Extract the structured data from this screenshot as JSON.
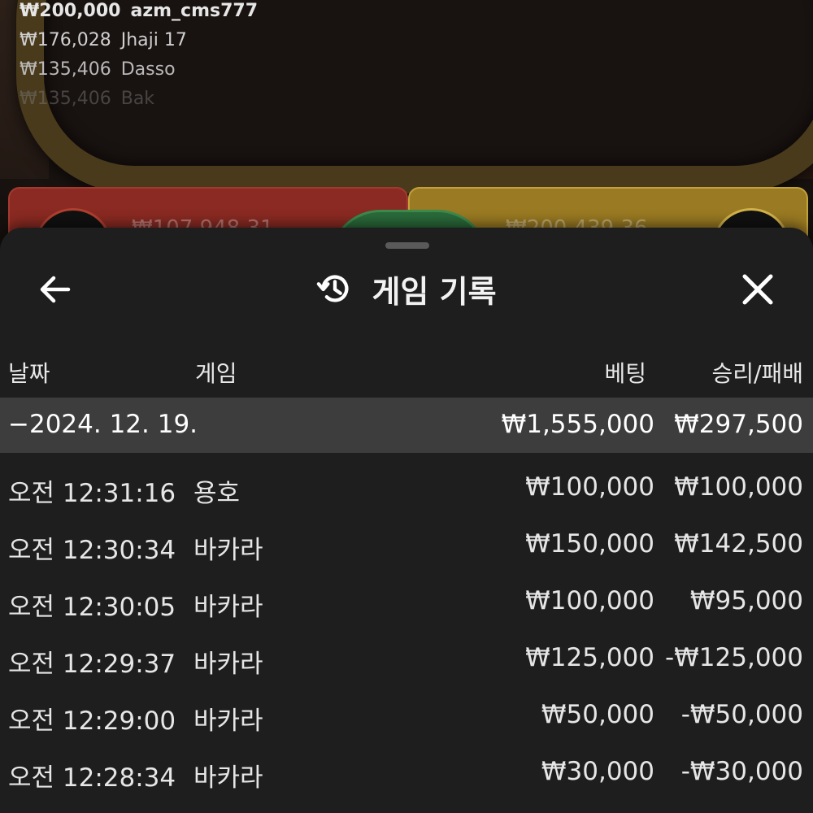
{
  "leaderboard": [
    {
      "amount": "₩200,000",
      "name": "azm_cms777"
    },
    {
      "amount": "₩176,028",
      "name": "Jhaji 17"
    },
    {
      "amount": "₩135,406",
      "name": "Dasso"
    },
    {
      "amount": "₩135,406",
      "name": "Bak"
    }
  ],
  "table": {
    "dragon_total": "₩107,948.31",
    "tiger_total": "₩200,439.36"
  },
  "sheet": {
    "title": "게임 기록",
    "icons": {
      "back": "arrow-left-icon",
      "history": "history-icon",
      "close": "close-icon"
    },
    "columns": {
      "date": "날짜",
      "game": "게임",
      "bet": "베팅",
      "result": "승리/패배"
    },
    "summary": {
      "date": "−2024. 12. 19.",
      "bet": "₩1,555,000",
      "result": "₩297,500"
    },
    "rows": [
      {
        "time": "오전 12:31:16",
        "game": "용호",
        "bet": "₩100,000",
        "result": "₩100,000"
      },
      {
        "time": "오전 12:30:34",
        "game": "바카라",
        "bet": "₩150,000",
        "result": "₩142,500"
      },
      {
        "time": "오전 12:30:05",
        "game": "바카라",
        "bet": "₩100,000",
        "result": "₩95,000"
      },
      {
        "time": "오전 12:29:37",
        "game": "바카라",
        "bet": "₩125,000",
        "result": "-₩125,000"
      },
      {
        "time": "오전 12:29:00",
        "game": "바카라",
        "bet": "₩50,000",
        "result": "-₩50,000"
      },
      {
        "time": "오전 12:28:34",
        "game": "바카라",
        "bet": "₩30,000",
        "result": "-₩30,000"
      }
    ]
  },
  "colors": {
    "sheet_bg": "#1e1e1e",
    "summary_bg": "#3d3d3d",
    "dragon": "#8a2a22",
    "tiger": "#9a7a22",
    "tie": "#2a6a3a"
  }
}
